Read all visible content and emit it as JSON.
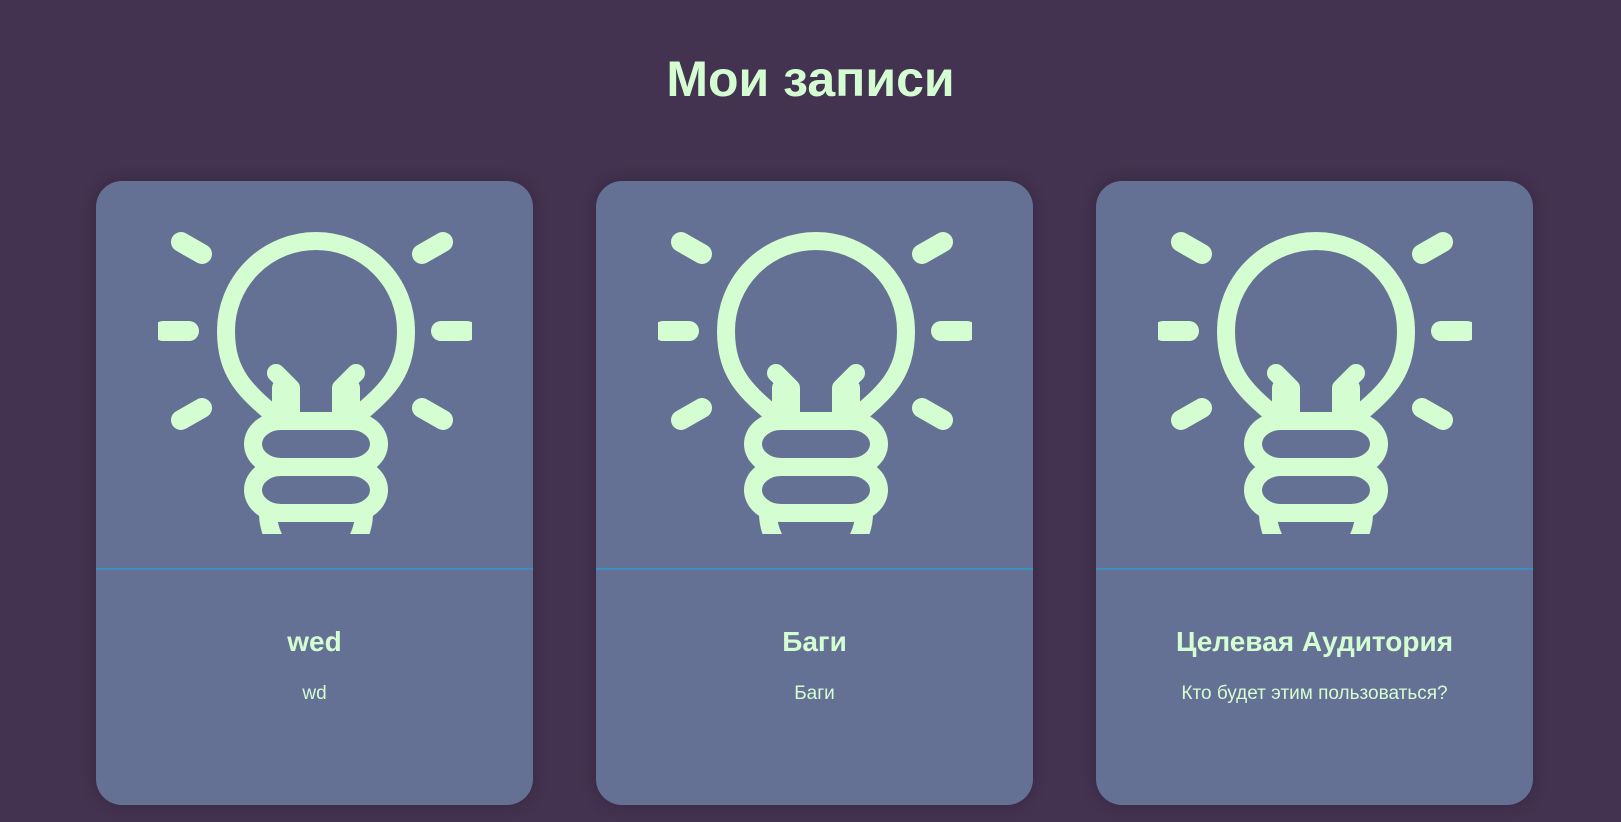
{
  "header": {
    "title": "Мои записи"
  },
  "theme": {
    "background": "#443350",
    "card": "#657194",
    "accent": "#d5fdd2",
    "divider": "#3d8fbf"
  },
  "cards": [
    {
      "icon": "lightbulb-icon",
      "title": "wed",
      "text": "wd"
    },
    {
      "icon": "lightbulb-icon",
      "title": "Баги",
      "text": "Баги"
    },
    {
      "icon": "lightbulb-icon",
      "title": "Целевая Аудитория",
      "text": "Кто будет этим пользоваться?"
    }
  ]
}
